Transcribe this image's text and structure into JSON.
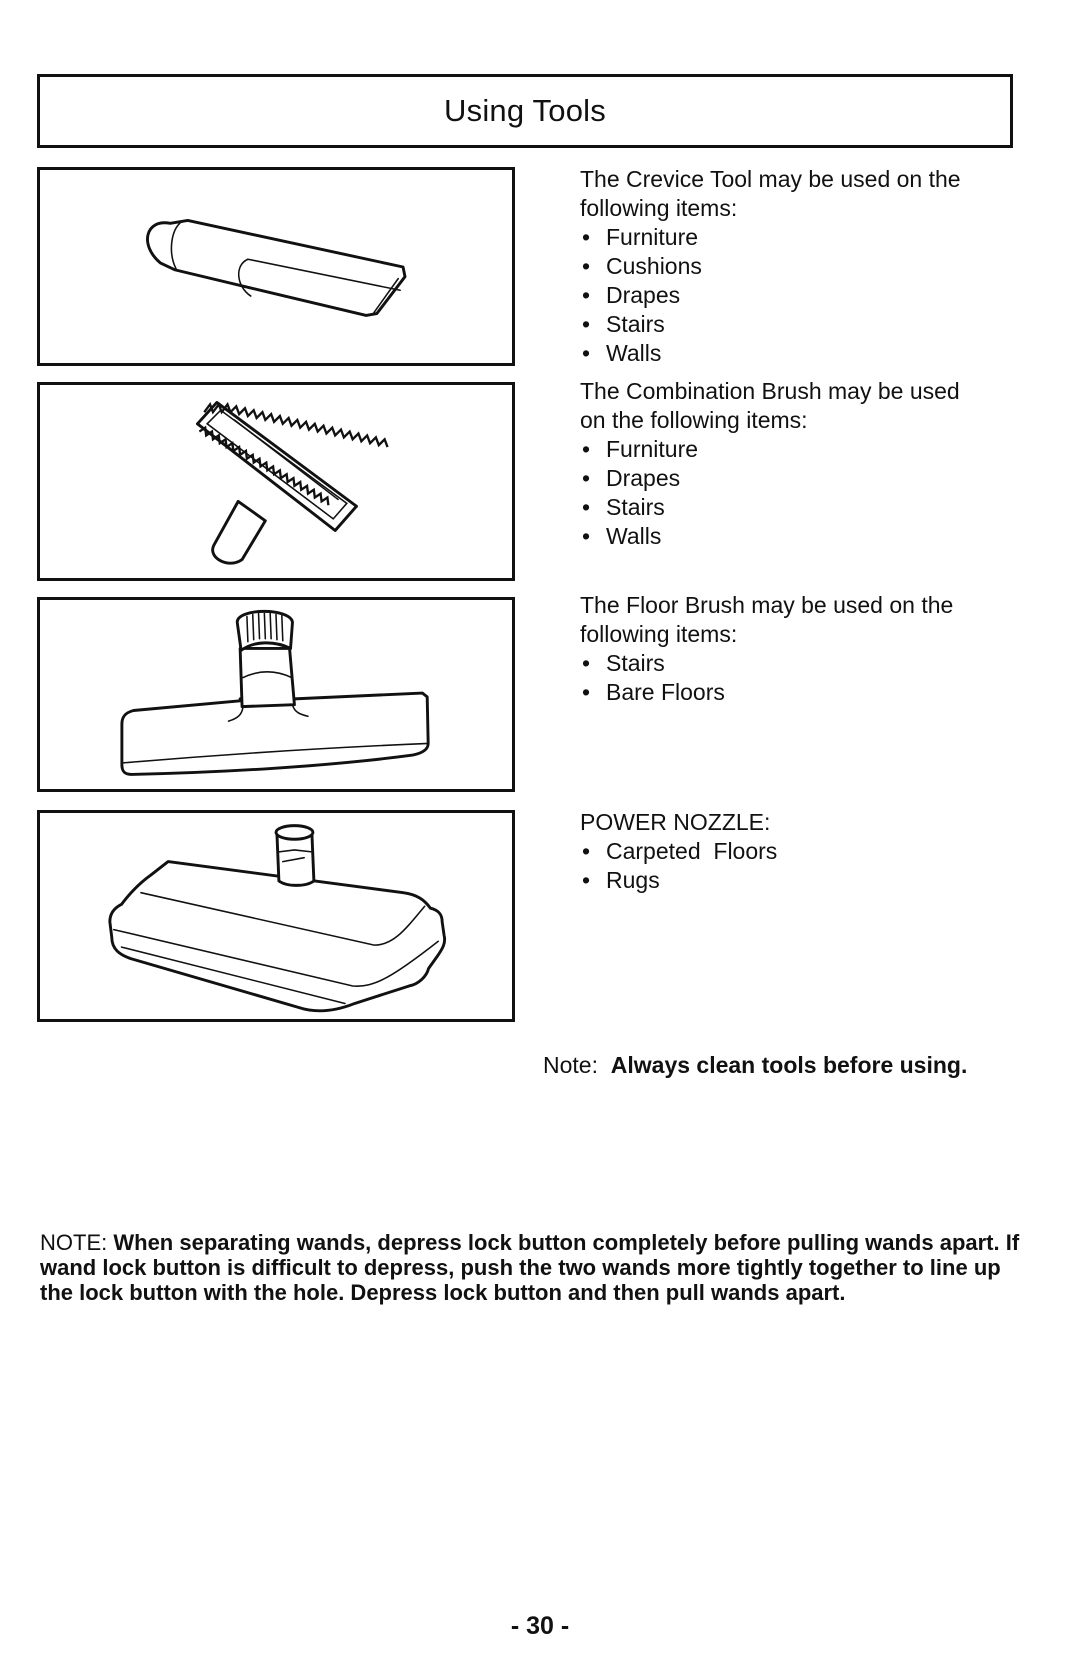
{
  "title": "Using Tools",
  "sections": [
    {
      "tool": "crevice-tool",
      "intro_line1": "The Crevice Tool may be used on the",
      "intro_line2": "following items:",
      "items": [
        "Furniture",
        "Cushions",
        "Drapes",
        "Stairs",
        "Walls"
      ]
    },
    {
      "tool": "combination-brush",
      "intro_line1": "The Combination Brush may be used",
      "intro_line2": "on the following items:",
      "items": [
        "Furniture",
        "Drapes",
        "Stairs",
        "Walls"
      ]
    },
    {
      "tool": "floor-brush",
      "intro_line1": "The Floor Brush may be used on the",
      "intro_line2": "following items:",
      "items": [
        "Stairs",
        "Bare Floors"
      ]
    },
    {
      "tool": "power-nozzle",
      "intro_line1": "POWER NOZZLE:",
      "items": [
        "Carpeted  Floors",
        "Rugs"
      ]
    }
  ],
  "note": {
    "label": "Note:",
    "text": "Always clean tools before using."
  },
  "bottom_note": {
    "label": "NOTE:",
    "line1": "When separating wands, depress lock button completely before pulling wands apart. If",
    "line2": "wand lock button is difficult to depress, push the two wands more tightly together to line up",
    "line3": "the lock button with the hole. Depress lock button and then pull wands apart."
  },
  "page_number": "- 30 -"
}
